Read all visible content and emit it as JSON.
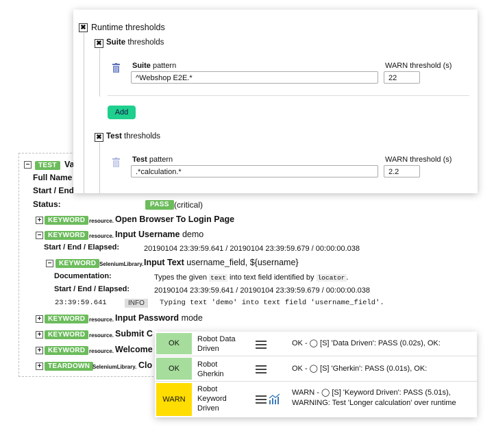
{
  "log": {
    "test_badge": "TEST",
    "test_name": "Va",
    "full_name_label": "Full Name",
    "start_end_label_partial": "Start / End",
    "status_label": "Status:",
    "status_value": "PASS",
    "status_note": "(critical)",
    "keywords": [
      {
        "expander": "+",
        "badge": "KEYWORD",
        "lib": "resource",
        "name": "Open Browser To Login Page",
        "args": ""
      },
      {
        "expander": "−",
        "badge": "KEYWORD",
        "lib": "resource",
        "name": "Input Username",
        "args": "demo"
      },
      {
        "expander": "+",
        "badge": "KEYWORD",
        "lib": "resource",
        "name": "Input Password",
        "args": "mode"
      },
      {
        "expander": "+",
        "badge": "KEYWORD",
        "lib": "resource",
        "name": "Submit C",
        "args": ""
      },
      {
        "expander": "+",
        "badge": "KEYWORD",
        "lib": "resource",
        "name": "Welcome",
        "args": ""
      },
      {
        "expander": "+",
        "badge": "TEARDOWN",
        "lib": "SeleniumLibrary",
        "name": "Clo",
        "args": ""
      }
    ],
    "input_username": {
      "timing_label": "Start / End / Elapsed:",
      "timing_value": "20190104 23:39:59.641 / 20190104 23:39:59.679 / 00:00:00.038",
      "sub": {
        "expander": "−",
        "badge": "KEYWORD",
        "lib": "SeleniumLibrary",
        "name": "Input Text",
        "args": "username_field, ${username}",
        "doc_label": "Documentation:",
        "doc_pre": "Types the given",
        "doc_code1": "text",
        "doc_mid": "into text field identified by",
        "doc_code2": "locator",
        "doc_post": ".",
        "timing_label": "Start / End / Elapsed:",
        "timing_value": "20190104 23:39:59.641 / 20190104 23:39:59.679 / 00:00:00.038",
        "msg_time": "23:39:59.641",
        "msg_level": "INFO",
        "msg_text": "Typing text 'demo' into text field 'username_field'."
      }
    }
  },
  "dialog": {
    "runtime_label": "Runtime thresholds",
    "suite_section_bold": "Suite",
    "suite_section_rest": "thresholds",
    "suite_pattern_bold": "Suite",
    "suite_pattern_rest": "pattern",
    "suite_pattern_value": "^Webshop E2E.*",
    "suite_warn_label": "WARN threshold (s)",
    "suite_warn_value": "22",
    "add_label": "Add",
    "test_section_bold": "Test",
    "test_section_rest": "thresholds",
    "test_pattern_bold": "Test",
    "test_pattern_rest": "pattern",
    "test_pattern_value": ".*calculation.*",
    "test_warn_label": "WARN threshold (s)",
    "test_warn_value": "2.2"
  },
  "status_table": {
    "rows": [
      {
        "state": "OK",
        "name_lines": [
          "Robot Data",
          "Driven"
        ],
        "message": [
          "OK - ◯ [S] 'Data Driven': PASS (0.02s), OK:"
        ],
        "color": "#a6dd9c",
        "graph": false
      },
      {
        "state": "OK",
        "name_lines": [
          "Robot",
          "Gherkin"
        ],
        "message": [
          "OK - ◯ [S] 'Gherkin': PASS (0.01s), OK:"
        ],
        "color": "#a6dd9c",
        "graph": false
      },
      {
        "state": "WARN",
        "name_lines": [
          "Robot",
          "Keyword",
          "Driven"
        ],
        "message": [
          "WARN - ◯ [S] 'Keyword Driven': PASS (5.01s),",
          "WARNING: Test 'Longer calculation' over runtime"
        ],
        "color": "#ffdd00",
        "graph": true
      }
    ]
  },
  "colors": {
    "pass_green": "#6cbc5c",
    "add_button": "#1fcf8d",
    "ok_cell": "#a6dd9c",
    "warn_cell": "#ffdd00"
  },
  "icons": [
    "expand-icon",
    "collapse-icon",
    "trash-icon",
    "checkbox-checked-icon",
    "menu-icon",
    "graph-icon"
  ]
}
